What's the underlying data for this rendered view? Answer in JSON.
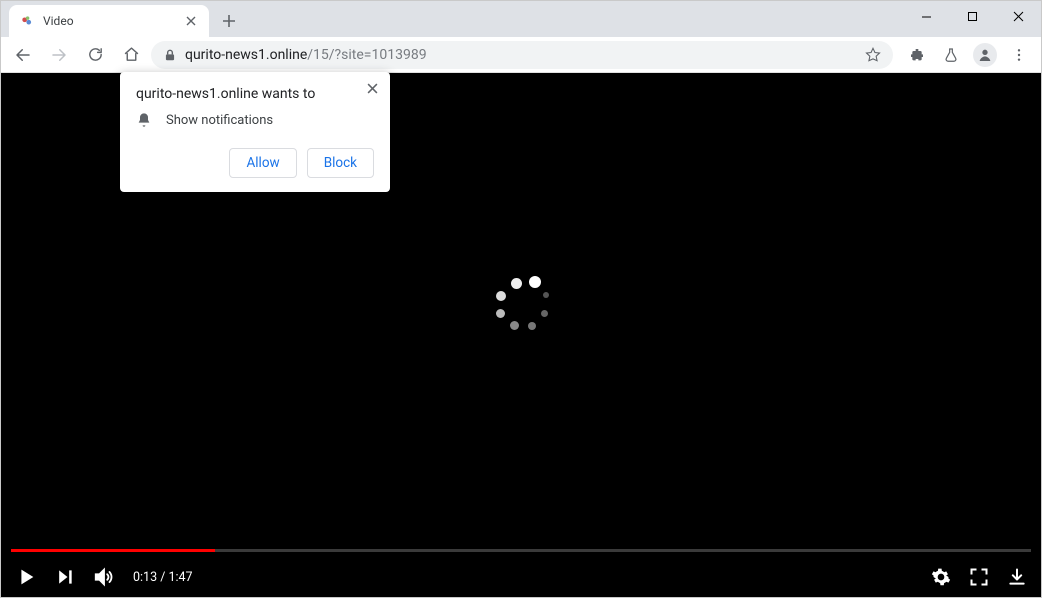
{
  "tab": {
    "title": "Video"
  },
  "url": {
    "domain": "qurito-news1.online",
    "path": "/15/?site=1013989"
  },
  "permission": {
    "headline": "qurito-news1.online wants to",
    "line": "Show notifications",
    "allow": "Allow",
    "block": "Block"
  },
  "video": {
    "elapsed": "0:13",
    "separator": " / ",
    "duration": "1:47",
    "progress_percent": 20
  }
}
